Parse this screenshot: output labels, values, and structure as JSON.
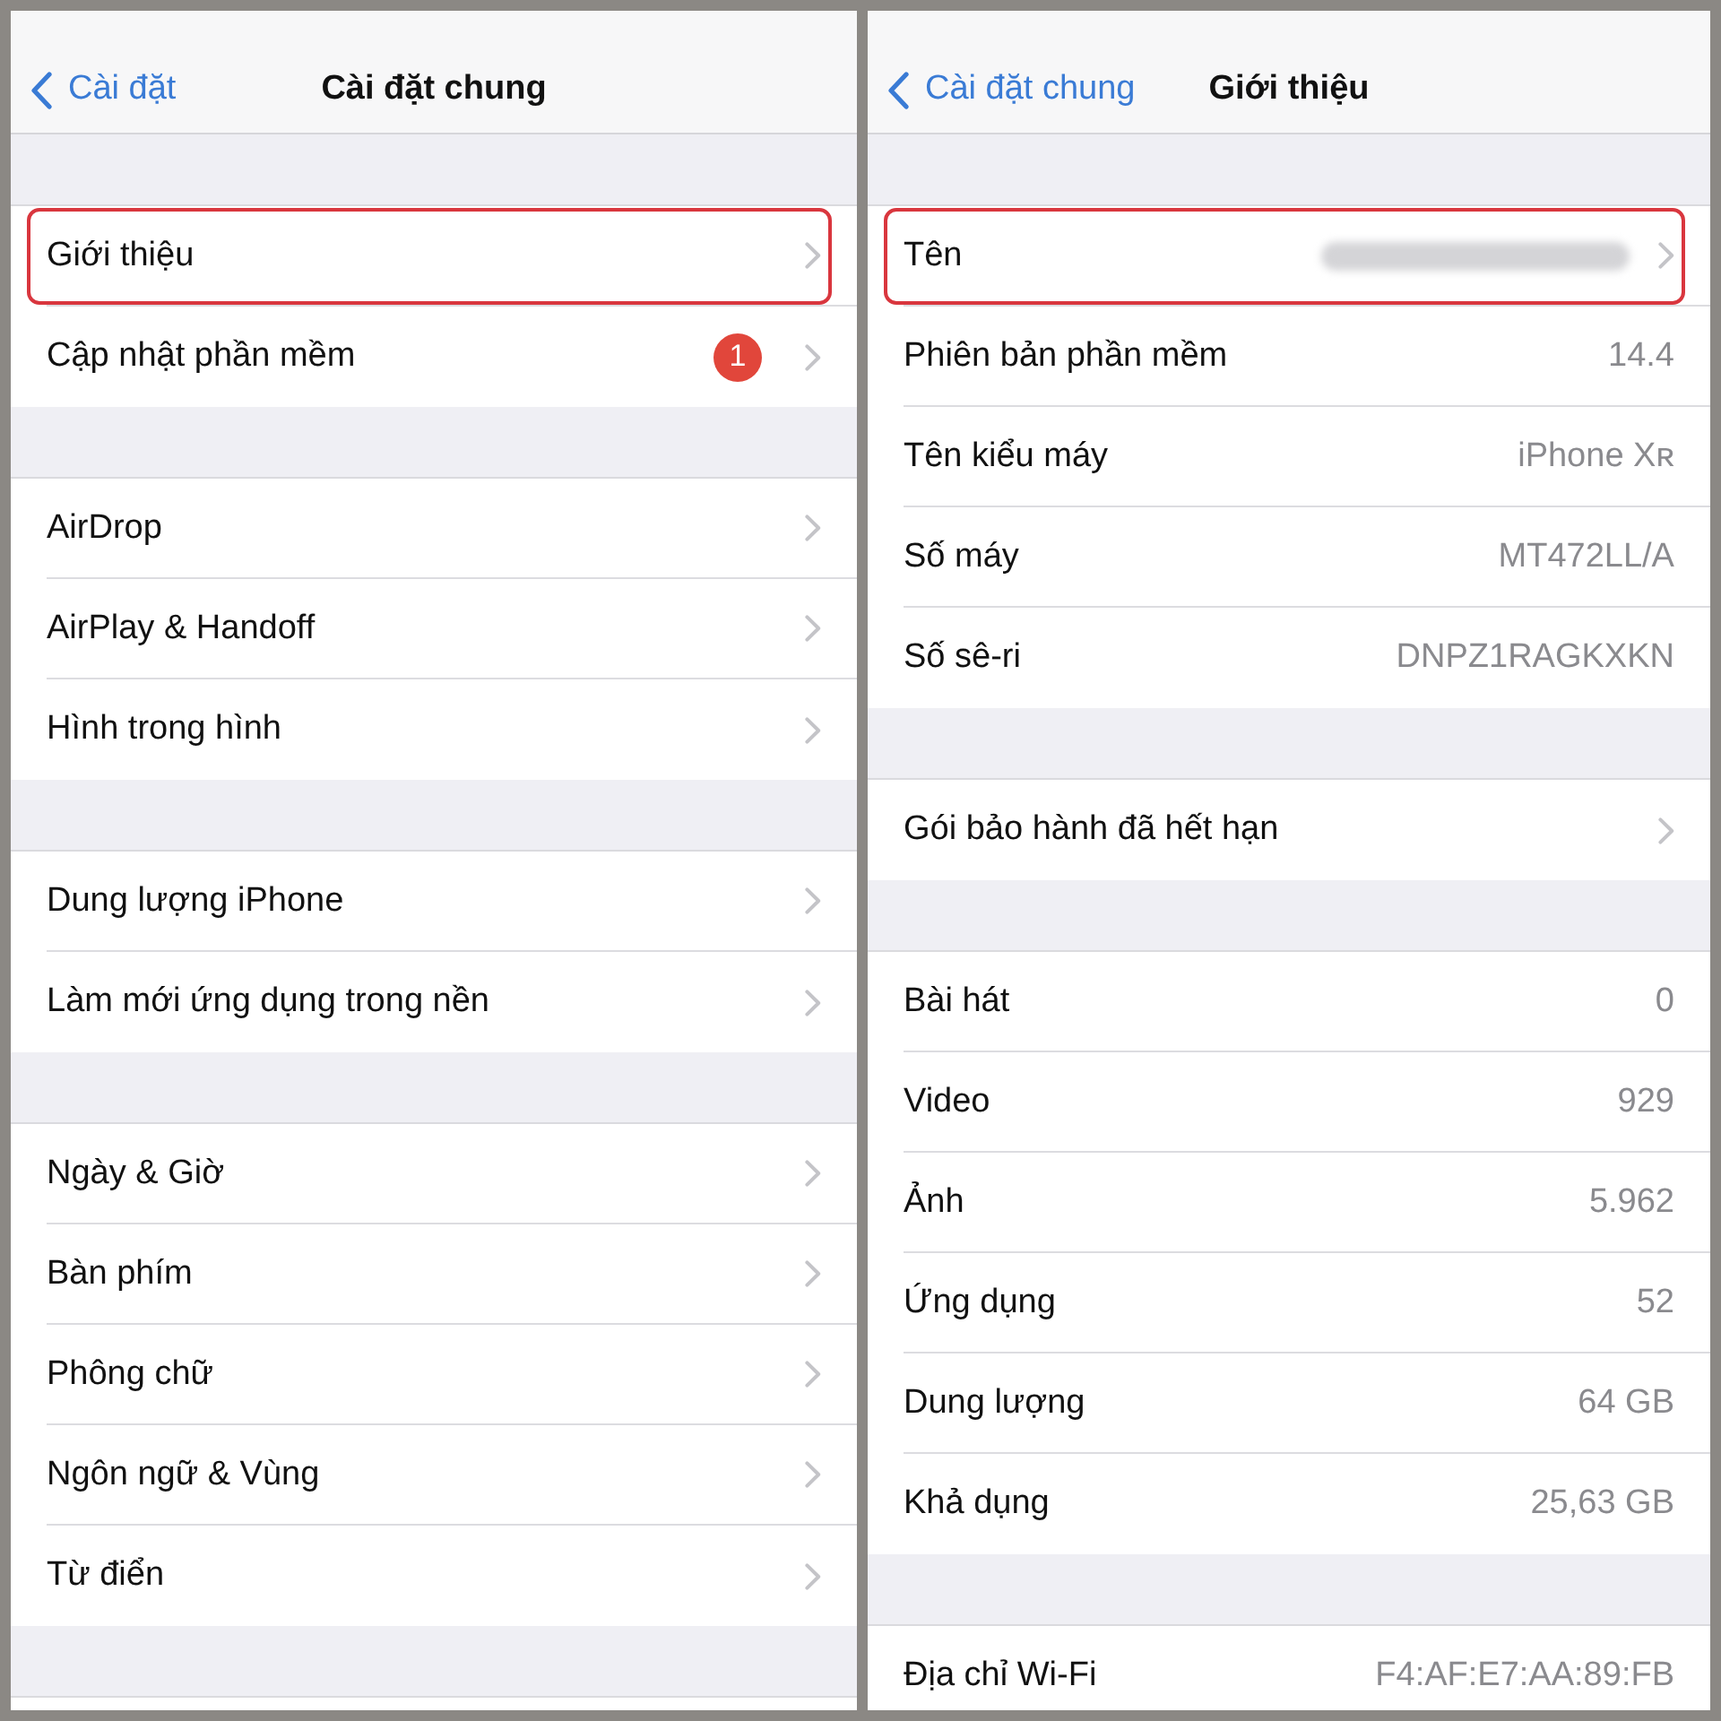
{
  "panels": [
    {
      "nav": {
        "back": "Cài đặt",
        "title": "Cài đặt chung"
      },
      "section_below": true,
      "groups": [
        {
          "rows": [
            {
              "label": "Giới thiệu",
              "chevron": true,
              "highlighted": true
            },
            {
              "label": "Cập nhật phần mềm",
              "badge": "1",
              "chevron": true,
              "highlighted": false
            }
          ]
        },
        {
          "rows": [
            {
              "label": "AirDrop",
              "chevron": true,
              "highlighted": false
            },
            {
              "label": "AirPlay & Handoff",
              "chevron": true,
              "highlighted": false
            },
            {
              "label": "Hình trong hình",
              "chevron": true,
              "highlighted": false
            }
          ]
        },
        {
          "rows": [
            {
              "label": "Dung lượng iPhone",
              "chevron": true,
              "highlighted": false
            },
            {
              "label": "Làm mới ứng dụng trong nền",
              "chevron": true,
              "highlighted": false
            }
          ]
        },
        {
          "rows": [
            {
              "label": "Ngày & Giờ",
              "chevron": true,
              "highlighted": false
            },
            {
              "label": "Bàn phím",
              "chevron": true,
              "highlighted": false
            },
            {
              "label": "Phông chữ",
              "chevron": true,
              "highlighted": false
            },
            {
              "label": "Ngôn ngữ & Vùng",
              "chevron": true,
              "highlighted": false
            },
            {
              "label": "Từ điển",
              "chevron": true,
              "highlighted": false
            }
          ]
        }
      ]
    },
    {
      "nav": {
        "back": "Cài đặt chung",
        "title": "Giới thiệu"
      },
      "section_below": false,
      "groups": [
        {
          "rows": [
            {
              "label": "Tên",
              "blurred": true,
              "chevron": true,
              "highlighted": true
            },
            {
              "label": "Phiên bản phần mềm",
              "value": "14.4",
              "blurred": false,
              "chevron": false,
              "highlighted": false
            },
            {
              "label": "Tên kiểu máy",
              "value": "iPhone Xʀ",
              "blurred": false,
              "chevron": false,
              "highlighted": false
            },
            {
              "label": "Số máy",
              "value": "MT472LL/A",
              "blurred": false,
              "chevron": false,
              "highlighted": false
            },
            {
              "label": "Số sê-ri",
              "value": "DNPZ1RAGKXKN",
              "blurred": false,
              "chevron": false,
              "highlighted": false
            }
          ]
        },
        {
          "rows": [
            {
              "label": "Gói bảo hành đã hết hạn",
              "blurred": false,
              "chevron": true,
              "highlighted": false
            }
          ]
        },
        {
          "rows": [
            {
              "label": "Bài hát",
              "value": "0",
              "blurred": false,
              "chevron": false,
              "highlighted": false
            },
            {
              "label": "Video",
              "value": "929",
              "blurred": false,
              "chevron": false,
              "highlighted": false
            },
            {
              "label": "Ảnh",
              "value": "5.962",
              "blurred": false,
              "chevron": false,
              "highlighted": false
            },
            {
              "label": "Ứng dụng",
              "value": "52",
              "blurred": false,
              "chevron": false,
              "highlighted": false
            },
            {
              "label": "Dung lượng",
              "value": "64 GB",
              "blurred": false,
              "chevron": false,
              "highlighted": false
            },
            {
              "label": "Khả dụng",
              "value": "25,63 GB",
              "blurred": false,
              "chevron": false,
              "highlighted": false
            }
          ]
        },
        {
          "rows": [
            {
              "label": "Địa chỉ Wi-Fi",
              "value": "F4:AF:E7:AA:89:FB",
              "blurred": false,
              "chevron": false,
              "highlighted": false
            }
          ]
        }
      ]
    }
  ]
}
